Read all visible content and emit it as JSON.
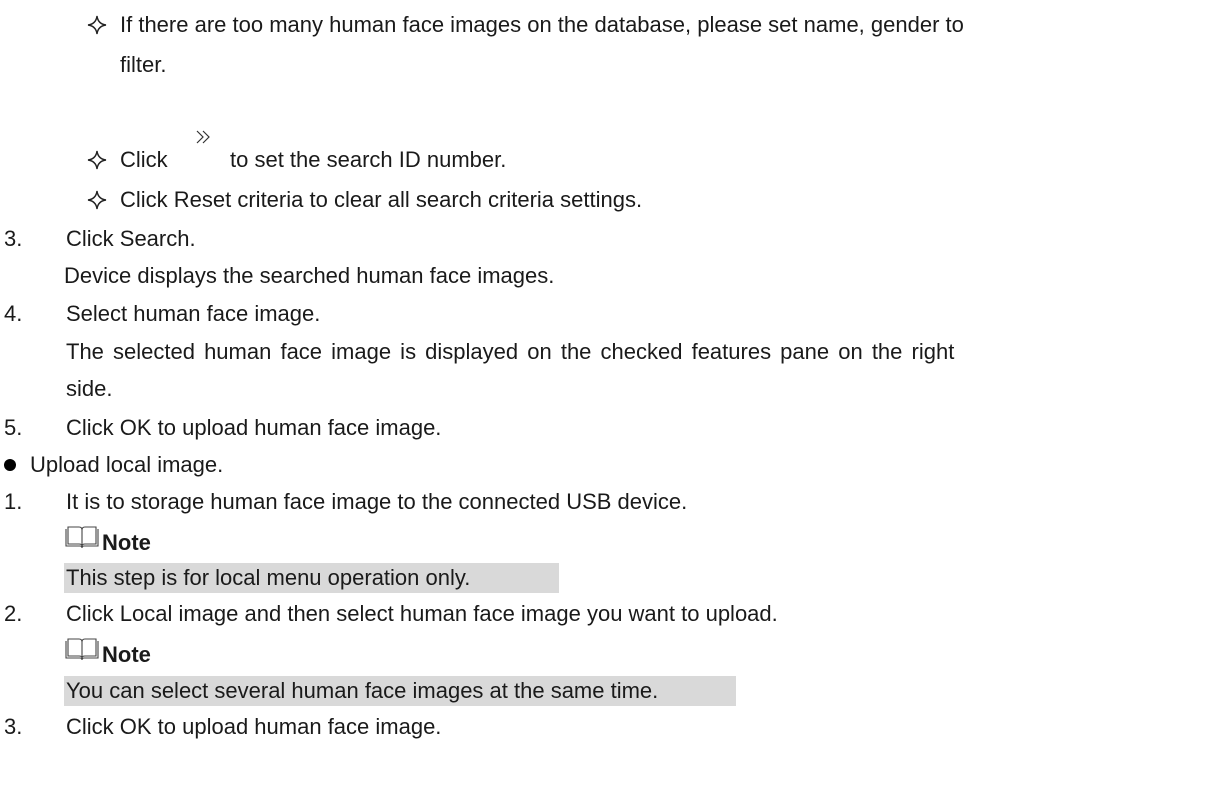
{
  "sub_items": [
    {
      "line1": "If there are too many human face images on the database, please set name, gender to",
      "line2": "filter."
    },
    {
      "before": "Click",
      "after": "to set the search ID number."
    },
    {
      "text": "Click Reset criteria to clear all search criteria settings."
    }
  ],
  "steps_a": [
    {
      "num": "3.",
      "text": "Click Search.",
      "desc": "Device displays the searched human face images."
    },
    {
      "num": "4.",
      "text": "Select human face image.",
      "desc1": "The selected human face image is displayed on the checked features pane on the right",
      "desc2": "side."
    },
    {
      "num": "5.",
      "text": "Click OK to upload human face image."
    }
  ],
  "bullet": "Upload local image.",
  "steps_b": [
    {
      "num": "1.",
      "text": "It is to storage human face image to the connected USB device.",
      "note_label": "Note",
      "note_text": "This step is for local menu operation only."
    },
    {
      "num": "2.",
      "text": "Click Local image and then select human face image you want to upload.",
      "note_label": "Note",
      "note_text": "You can select several human face images at the same time."
    },
    {
      "num": "3.",
      "text": "Click OK to upload human face image."
    }
  ],
  "icons": {
    "diamond": "four-pointed-star-outline-icon",
    "chevron": "double-chevron-right-icon",
    "note": "open-book-icon"
  }
}
